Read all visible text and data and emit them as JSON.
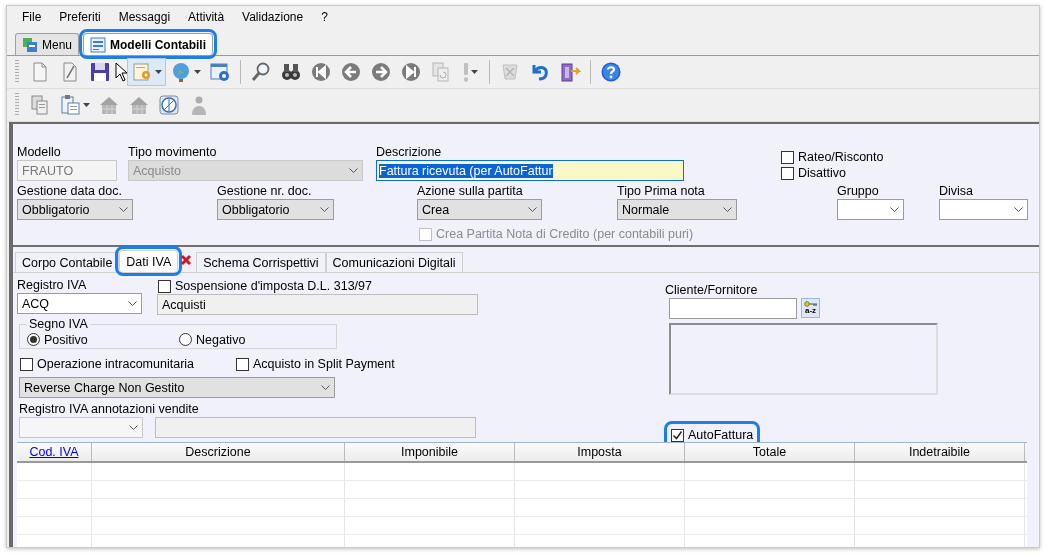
{
  "menu": [
    "File",
    "Preferiti",
    "Messaggi",
    "Attività",
    "Validazione",
    "?"
  ],
  "doc_tabs": [
    {
      "label": "Menu",
      "selected": false,
      "highlighted": false
    },
    {
      "label": "Modelli Contabili",
      "selected": true,
      "highlighted": true
    }
  ],
  "toolbars": [
    [
      {
        "kind": "button",
        "dropdown": false,
        "disabled": false,
        "hovered": false
      },
      {
        "kind": "button",
        "dropdown": false,
        "disabled": false,
        "hovered": false
      },
      {
        "kind": "button",
        "dropdown": false,
        "disabled": false,
        "hovered": false
      },
      {
        "kind": "button",
        "dropdown": true,
        "disabled": false,
        "hovered": true
      },
      {
        "kind": "button",
        "dropdown": true,
        "disabled": false,
        "hovered": false
      },
      {
        "kind": "button",
        "dropdown": false,
        "disabled": false,
        "hovered": false
      },
      {
        "kind": "separator"
      },
      {
        "kind": "button",
        "dropdown": false,
        "disabled": false,
        "hovered": false
      },
      {
        "kind": "button",
        "dropdown": false,
        "disabled": false,
        "hovered": false
      },
      {
        "kind": "button",
        "dropdown": false,
        "disabled": false,
        "hovered": false
      },
      {
        "kind": "button",
        "dropdown": false,
        "disabled": false,
        "hovered": false
      },
      {
        "kind": "button",
        "dropdown": false,
        "disabled": false,
        "hovered": false
      },
      {
        "kind": "button",
        "dropdown": false,
        "disabled": false,
        "hovered": false
      },
      {
        "kind": "button",
        "dropdown": false,
        "disabled": true,
        "hovered": false
      },
      {
        "kind": "button",
        "dropdown": true,
        "disabled": true,
        "hovered": false
      },
      {
        "kind": "separator"
      },
      {
        "kind": "button",
        "dropdown": false,
        "disabled": true,
        "hovered": false
      },
      {
        "kind": "button",
        "dropdown": false,
        "disabled": false,
        "hovered": false
      },
      {
        "kind": "button",
        "dropdown": false,
        "disabled": false,
        "hovered": false
      },
      {
        "kind": "separator"
      },
      {
        "kind": "button",
        "dropdown": false,
        "disabled": false,
        "hovered": false
      }
    ],
    [
      {
        "kind": "button",
        "dropdown": false,
        "disabled": false,
        "hovered": false
      },
      {
        "kind": "button",
        "dropdown": true,
        "disabled": false,
        "hovered": false
      },
      {
        "kind": "button",
        "dropdown": false,
        "disabled": true,
        "hovered": false
      },
      {
        "kind": "button",
        "dropdown": false,
        "disabled": true,
        "hovered": false
      },
      {
        "kind": "button",
        "dropdown": false,
        "disabled": false,
        "hovered": false
      },
      {
        "kind": "button",
        "dropdown": false,
        "disabled": true,
        "hovered": false
      }
    ]
  ],
  "header_rows": [
    [
      {
        "kind": "text",
        "label": "Modello",
        "value": "FRAUTO",
        "disabled": true
      },
      {
        "kind": "select",
        "label": "Tipo movimento",
        "value": "Acquisto",
        "disabled": true
      },
      {
        "kind": "text",
        "label": "Descrizione",
        "value": "Fattura ricevuta (per AutoFattur",
        "disabled": false,
        "text_selected": true
      },
      {
        "kind": "checks",
        "items": [
          {
            "label": "Rateo/Risconto",
            "checked": false,
            "disabled": false
          },
          {
            "label": "Disattivo",
            "checked": false,
            "disabled": false
          }
        ]
      }
    ],
    [
      {
        "kind": "select",
        "label": "Gestione data doc.",
        "value": "Obbligatorio",
        "disabled": false
      },
      {
        "kind": "select",
        "label": "Gestione nr. doc.",
        "value": "Obbligatorio",
        "disabled": false
      },
      {
        "kind": "select",
        "label": "Azione sulla partita",
        "value": "Crea",
        "disabled": false
      },
      {
        "kind": "select",
        "label": "Tipo Prima nota",
        "value": "Normale",
        "disabled": false
      },
      {
        "kind": "select",
        "label": "Gruppo",
        "disabled": false,
        "empty": true
      },
      {
        "kind": "select",
        "label": "Divisa",
        "disabled": false,
        "empty": true
      }
    ],
    [
      {
        "kind": "checks",
        "items": [
          {
            "label": "Crea Partita Nota di Credito (per contabili puri)",
            "checked": false,
            "disabled": true
          }
        ]
      }
    ]
  ],
  "detail_tabs": [
    {
      "label": "Corpo Contabile",
      "selected": false,
      "highlighted": false
    },
    {
      "label": "Dati IVA",
      "selected": true,
      "highlighted": true
    },
    {
      "label": "Schema Corrispettivi",
      "selected": false,
      "highlighted": false
    },
    {
      "label": "Comunicazioni Digitali",
      "selected": false,
      "highlighted": false
    }
  ],
  "dati_iva": {
    "registro_iva": {
      "label": "Registro IVA",
      "value": "ACQ"
    },
    "sospensione": {
      "label": "Sospensione d'imposta D.L. 313/97",
      "checked": false
    },
    "registro_descrizione": {
      "value": "Acquisti"
    },
    "segno_iva": {
      "legend": "Segno IVA",
      "options": [
        {
          "label": "Positivo",
          "selected": true
        },
        {
          "label": "Negativo",
          "selected": false
        }
      ]
    },
    "checks": [
      {
        "label": "Operazione intracomunitaria",
        "checked": false
      },
      {
        "label": "Acquisto in Split Payment",
        "checked": false
      }
    ],
    "reverse_charge": {
      "value": "Reverse Charge Non Gestito"
    },
    "registro_annotazioni": {
      "label": "Registro IVA annotazioni vendite",
      "disabled": true
    },
    "cliente_fornitore": {
      "label": "Cliente/Fornitore",
      "lookup_button": "a-z"
    },
    "autofattura": {
      "label": "AutoFattura",
      "checked": true,
      "highlighted": true
    }
  },
  "table": {
    "columns": [
      {
        "label": "Cod. IVA",
        "kind": "link"
      },
      {
        "label": "Descrizione",
        "kind": "text"
      },
      {
        "label": "Imponibile",
        "kind": "text"
      },
      {
        "label": "Imposta",
        "kind": "text"
      },
      {
        "label": "Totale",
        "kind": "text"
      },
      {
        "label": "Indetraibile",
        "kind": "text"
      }
    ]
  }
}
